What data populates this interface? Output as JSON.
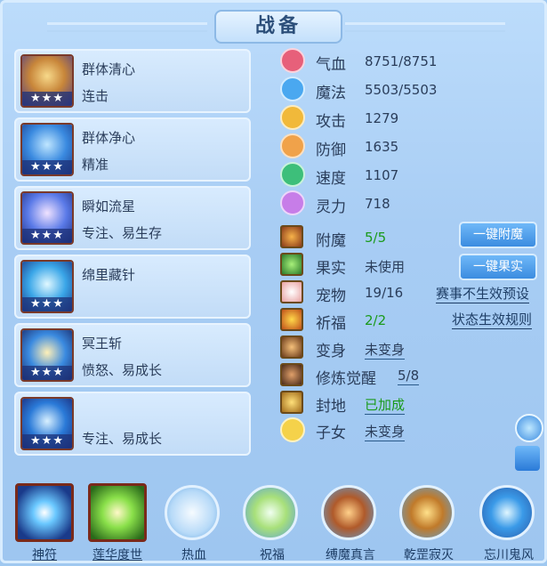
{
  "title": "战备",
  "skills": [
    {
      "name": "群体清心",
      "desc": "连击",
      "stars": "★★★"
    },
    {
      "name": "群体净心",
      "desc": "精准",
      "stars": "★★★"
    },
    {
      "name": "瞬如流星",
      "desc": "专注、易生存",
      "stars": "★★★"
    },
    {
      "name": "绵里藏针",
      "desc": "",
      "stars": "★★★"
    },
    {
      "name": "冥王斩",
      "desc": "愤怒、易成长",
      "stars": "★★★"
    },
    {
      "name": "",
      "desc": "专注、易成长",
      "stars": "★★★"
    }
  ],
  "stats": [
    {
      "label": "气血",
      "value": "8751/8751",
      "icon": "heart-icon",
      "color": "#e7607a"
    },
    {
      "label": "魔法",
      "value": "5503/5503",
      "icon": "mana-icon",
      "color": "#4aa8f0"
    },
    {
      "label": "攻击",
      "value": "1279",
      "icon": "sword-icon",
      "color": "#f1b93a"
    },
    {
      "label": "防御",
      "value": "1635",
      "icon": "shield-icon",
      "color": "#f0a24a"
    },
    {
      "label": "速度",
      "value": "1107",
      "icon": "lightning-icon",
      "color": "#3dbf7a"
    },
    {
      "label": "灵力",
      "value": "718",
      "icon": "spirit-icon",
      "color": "#c77de8"
    }
  ],
  "rows": {
    "fumo": {
      "label": "附魔",
      "value": "5/5"
    },
    "guoshi": {
      "label": "果实",
      "value": "未使用"
    },
    "chongwu": {
      "label": "宠物",
      "value": "19/16"
    },
    "qifu": {
      "label": "祈福",
      "value": "2/2"
    },
    "bianshen": {
      "label": "变身",
      "value": "未变身"
    },
    "xiulian": {
      "label": "修炼觉醒",
      "value": "5/8"
    },
    "fengdi": {
      "label": "封地",
      "value": "已加成"
    },
    "zinv": {
      "label": "子女",
      "value": "未变身"
    }
  },
  "buttons": {
    "one_click_enchant": "一键附魔",
    "one_click_fruit": "一键果实"
  },
  "links": {
    "event_preset": "赛事不生效预设",
    "status_rules": "状态生效规则"
  },
  "bottom_bar": [
    {
      "label": "神符"
    },
    {
      "label": "莲华度世"
    },
    {
      "label": "热血"
    },
    {
      "label": "祝福"
    },
    {
      "label": "缚魔真言"
    },
    {
      "label": "乾罡寂灭"
    },
    {
      "label": "忘川鬼风"
    }
  ],
  "colors": {
    "accent_green": "#1a9a1a",
    "button_blue": "#3b8ce0",
    "text_dark": "#2a3d5a"
  }
}
